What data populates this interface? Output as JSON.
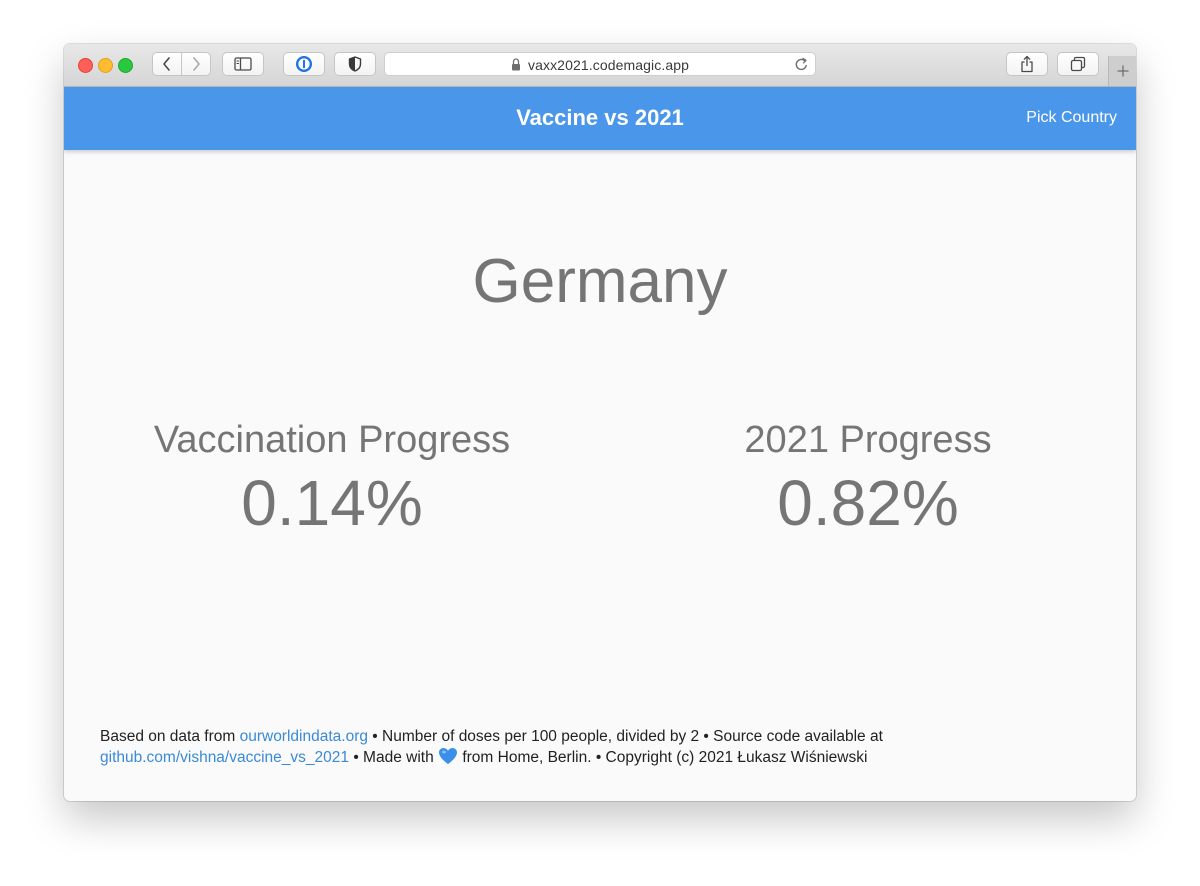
{
  "browser": {
    "url": "vaxx2021.codemagic.app"
  },
  "header": {
    "title": "Vaccine vs 2021",
    "pick_country": "Pick Country",
    "background_color": "#4a96ea"
  },
  "main": {
    "country": "Germany",
    "stats": [
      {
        "label": "Vaccination Progress",
        "value": "0.14%"
      },
      {
        "label": "2021 Progress",
        "value": "0.82%"
      }
    ]
  },
  "footer": {
    "text_1": "Based on data from ",
    "link_1": "ourworldindata.org",
    "text_2": " • Number of doses per 100 people, divided by 2 • Source code available at ",
    "link_2": "github.com/vishna/vaccine_vs_2021",
    "text_3": " • Made with ",
    "heart_icon": "blue-heart-icon",
    "text_4": " from Home, Berlin. • Copyright (c) 2021 Łukasz Wiśniewski",
    "link_color": "#3a8ad6"
  }
}
